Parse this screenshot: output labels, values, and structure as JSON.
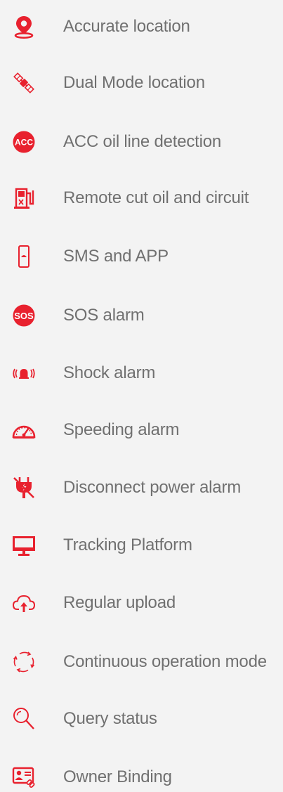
{
  "accent_color": "#e8212e",
  "text_color": "#707070",
  "background_color": "#f3f3f3",
  "features": [
    {
      "icon": "location-pin-icon",
      "label": "Accurate location"
    },
    {
      "icon": "satellite-icon",
      "label": "Dual Mode location"
    },
    {
      "icon": "acc-badge-icon",
      "icon_text": "ACC",
      "label": "ACC oil line detection"
    },
    {
      "icon": "fuel-pump-icon",
      "label": "Remote cut oil and circuit"
    },
    {
      "icon": "phone-icon",
      "label": "SMS and APP"
    },
    {
      "icon": "sos-badge-icon",
      "icon_text": "SOS",
      "label": "SOS alarm"
    },
    {
      "icon": "vibrating-bell-icon",
      "label": "Shock alarm"
    },
    {
      "icon": "speedometer-icon",
      "label": "Speeding alarm"
    },
    {
      "icon": "unplugged-power-icon",
      "label": "Disconnect power alarm"
    },
    {
      "icon": "monitor-icon",
      "label": "Tracking Platform"
    },
    {
      "icon": "cloud-upload-icon",
      "label": "Regular upload"
    },
    {
      "icon": "refresh-cycle-icon",
      "label": "Continuous operation mode"
    },
    {
      "icon": "magnifier-icon",
      "label": "Query status"
    },
    {
      "icon": "id-card-link-icon",
      "label": "Owner Binding"
    }
  ]
}
